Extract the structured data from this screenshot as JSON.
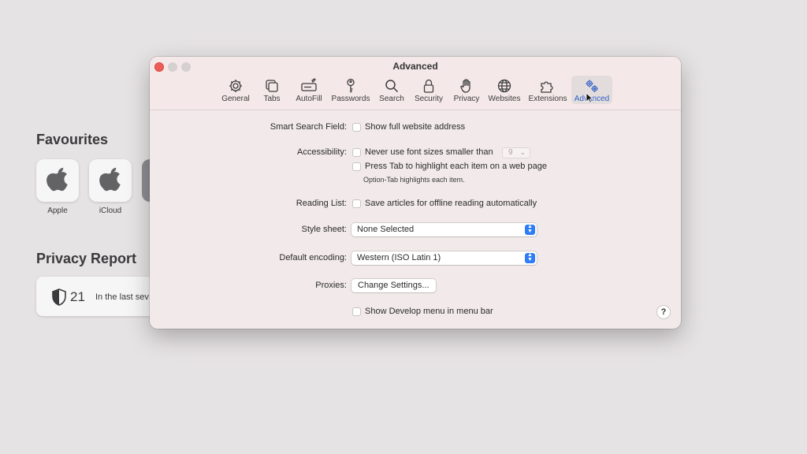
{
  "background": {
    "favourites_title": "Favourites",
    "favourites": [
      {
        "label": "Apple",
        "icon": "apple-logo-icon"
      },
      {
        "label": "iCloud",
        "icon": "apple-logo-icon"
      }
    ],
    "privacy_title": "Privacy Report",
    "privacy_count": "21",
    "privacy_text": "In the last sev"
  },
  "window": {
    "title": "Advanced",
    "tabs": [
      {
        "label": "General",
        "icon": "gear-icon"
      },
      {
        "label": "Tabs",
        "icon": "tabs-icon"
      },
      {
        "label": "AutoFill",
        "icon": "autofill-icon"
      },
      {
        "label": "Passwords",
        "icon": "key-icon"
      },
      {
        "label": "Search",
        "icon": "search-icon"
      },
      {
        "label": "Security",
        "icon": "lock-icon"
      },
      {
        "label": "Privacy",
        "icon": "hand-icon"
      },
      {
        "label": "Websites",
        "icon": "globe-icon"
      },
      {
        "label": "Extensions",
        "icon": "puzzle-icon"
      },
      {
        "label": "Advanced",
        "icon": "gears-icon",
        "active": true
      }
    ],
    "smart_search": {
      "label": "Smart Search Field:",
      "option": "Show full website address"
    },
    "accessibility": {
      "label": "Accessibility:",
      "option1": "Never use font sizes smaller than",
      "font_size": "9",
      "option2": "Press Tab to highlight each item on a web page",
      "hint": "Option-Tab highlights each item."
    },
    "reading_list": {
      "label": "Reading List:",
      "option": "Save articles for offline reading automatically"
    },
    "style_sheet": {
      "label": "Style sheet:",
      "value": "None Selected"
    },
    "encoding": {
      "label": "Default encoding:",
      "value": "Western (ISO Latin 1)"
    },
    "proxies": {
      "label": "Proxies:",
      "button": "Change Settings..."
    },
    "develop": {
      "option": "Show Develop menu in menu bar"
    },
    "help": "?"
  },
  "colors": {
    "accent": "#2f5fc4",
    "stepper": "#2e7cf6",
    "close": "#ee5e58"
  }
}
